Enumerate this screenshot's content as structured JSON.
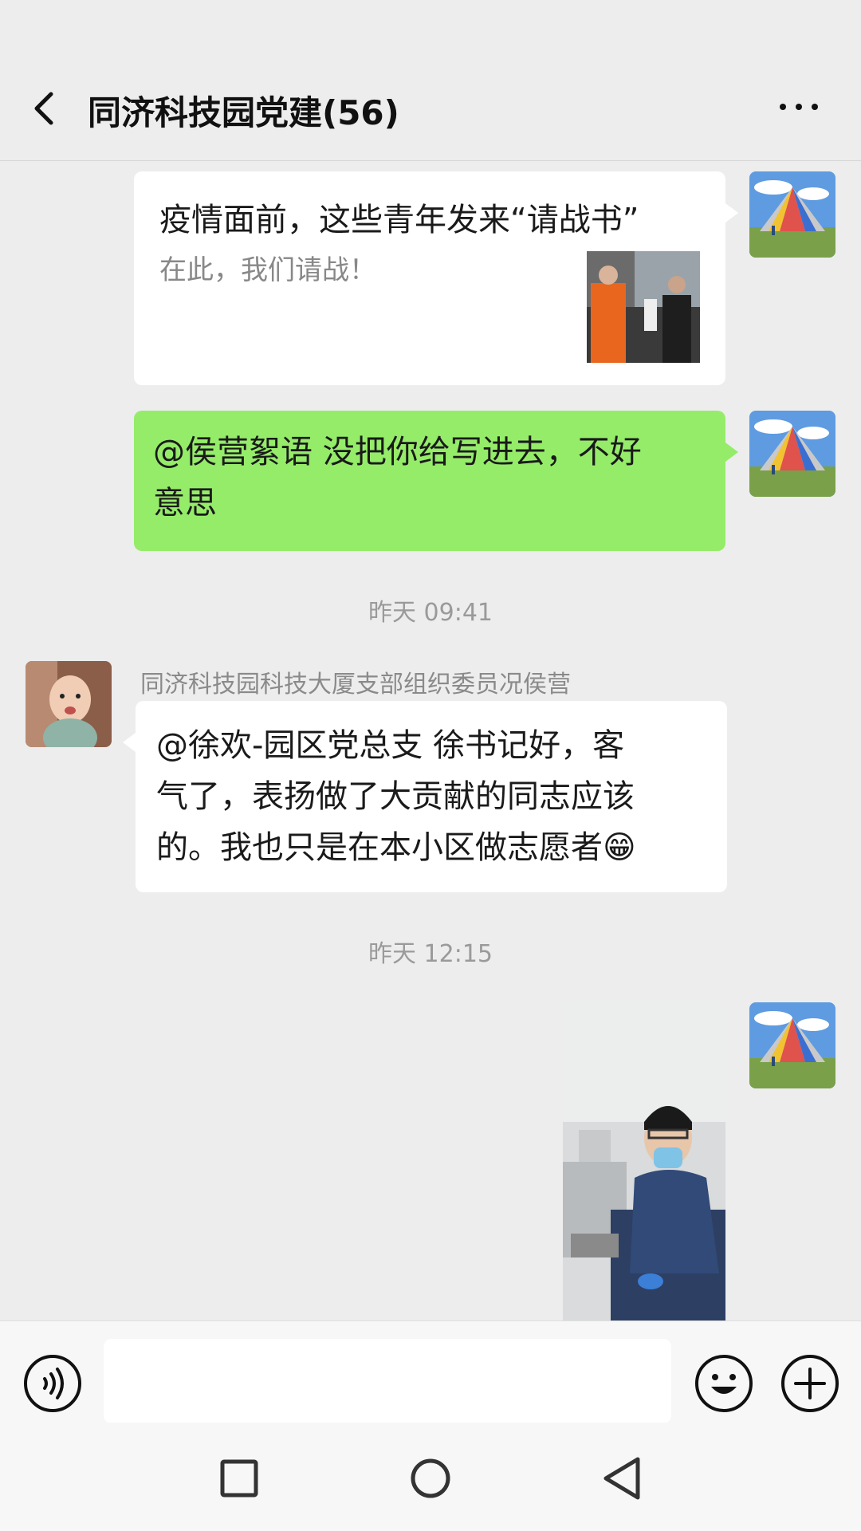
{
  "header": {
    "title": "同济科技园党建(56)",
    "back_icon": "back-icon",
    "more_icon": "more-icon"
  },
  "messages": {
    "card": {
      "title": "疫情面前，这些青年发来“请战书”",
      "desc": "在此，我们请战！"
    },
    "green_text": {
      "line1": "@侯营絮语  没把你给写进去，不好",
      "line2": "意思"
    },
    "timestamp1": "昨天 09:41",
    "incoming": {
      "sender": "同济科技园科技大厦支部组织委员况侯营",
      "line1": "@徐欢-园区党总支  徐书记好，客",
      "line2": "气了，表扬做了大贡献的同志应该",
      "line3": "的。我也只是在本小区做志愿者",
      "emoji": "😁"
    },
    "timestamp2": "昨天 12:15"
  },
  "input_bar": {
    "voice_icon": "voice-icon",
    "placeholder": "",
    "emoji_icon": "emoji-icon",
    "plus_icon": "plus-icon"
  },
  "nav": {
    "recents_icon": "square-icon",
    "home_icon": "circle-icon",
    "back_icon": "triangle-back-icon"
  },
  "colors": {
    "background": "#ededed",
    "green_bubble": "#95ec69",
    "white_bubble": "#ffffff"
  }
}
